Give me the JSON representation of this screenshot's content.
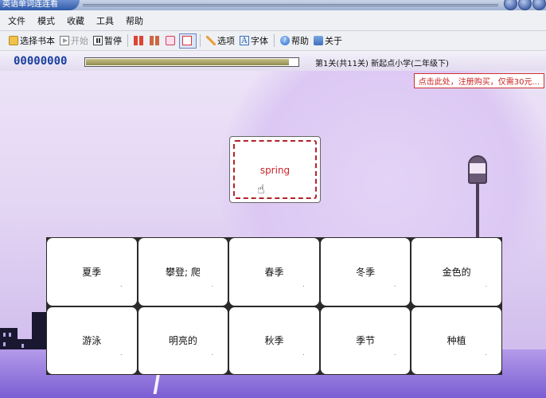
{
  "window": {
    "title": "英语单词连连看"
  },
  "menu": {
    "items": [
      "文件",
      "模式",
      "收藏",
      "工具",
      "帮助"
    ]
  },
  "toolbar": {
    "select_book": "选择书本",
    "start": "开始",
    "pause": "暂停",
    "options": "选项",
    "font": "字体",
    "font_icon": "A",
    "help": "帮助",
    "help_icon": "?",
    "about": "关于"
  },
  "status": {
    "score": "00000000",
    "progress_fraction": 0.96,
    "level_info": "第1关(共11关) 新起点小学(二年级下)"
  },
  "game": {
    "register_text": "点击此处，注册购买，仅需30元...",
    "current_word": "spring",
    "choices": [
      "夏季",
      "攀登; 爬",
      "春季",
      "冬季",
      "金色的",
      "游泳",
      "明亮的",
      "秋季",
      "季节",
      "种植"
    ]
  },
  "colors": {
    "score": "#1a3f9e",
    "word": "#c8232b",
    "register_border": "#cc3333",
    "background": "#e4d6f4"
  }
}
